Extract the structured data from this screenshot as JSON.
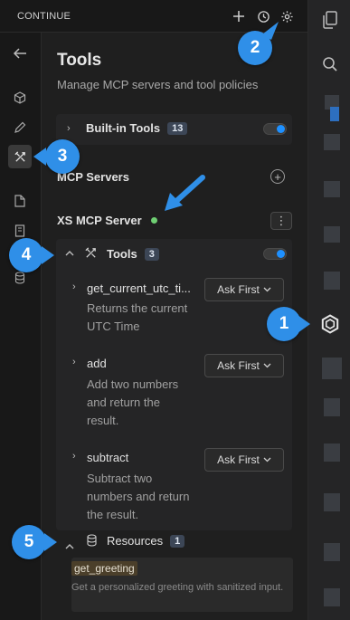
{
  "topbar": {
    "title": "CONTINUE"
  },
  "main": {
    "title": "Tools",
    "subtitle": "Manage MCP servers and tool policies",
    "builtin": {
      "label": "Built-in Tools",
      "count": "13"
    },
    "mcp_servers_label": "MCP Servers",
    "server": {
      "name": "XS MCP Server",
      "status_color": "#6fcf73"
    },
    "tools_section": {
      "label": "Tools",
      "count": "3"
    },
    "tools": [
      {
        "name": "get_current_utc_ti...",
        "desc_lines": [
          "Returns the current",
          "UTC Time"
        ],
        "policy": "Ask First"
      },
      {
        "name": "add",
        "desc_lines": [
          "Add two numbers",
          "and return the",
          "result."
        ],
        "policy": "Ask First"
      },
      {
        "name": "subtract",
        "desc_lines": [
          "Subtract two",
          "numbers and return",
          "the result."
        ],
        "policy": "Ask First"
      }
    ],
    "resources": {
      "label": "Resources",
      "count": "1",
      "item_name": "get_greeting",
      "item_desc": "Get a personalized greeting with sanitized input."
    }
  },
  "callouts": [
    "1",
    "2",
    "3",
    "4",
    "5"
  ],
  "colors": {
    "accent": "#2f8fe8",
    "toggle_on": "#1e90ff",
    "status_online": "#6fcf73"
  }
}
